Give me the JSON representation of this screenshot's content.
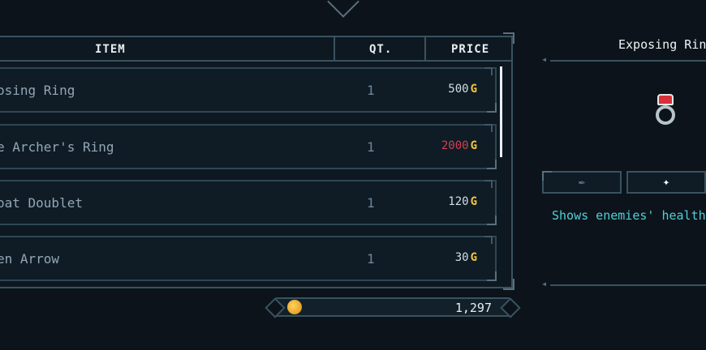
{
  "table": {
    "headers": {
      "item": "ITEM",
      "qty": "QT.",
      "price": "PRICE"
    },
    "rows": [
      {
        "name": "osing Ring",
        "qty": "1",
        "price": "500",
        "currency": "G",
        "affordable": true
      },
      {
        "name": "e Archer's Ring",
        "qty": "1",
        "price": "2000",
        "currency": "G",
        "affordable": false
      },
      {
        "name": "oat Doublet",
        "qty": "1",
        "price": "120",
        "currency": "G",
        "affordable": true
      },
      {
        "name": "en Arrow",
        "qty": "1",
        "price": "30",
        "currency": "G",
        "affordable": true
      }
    ]
  },
  "wallet": {
    "gold": "1,297",
    "icon": "coin-icon"
  },
  "detail": {
    "title": "Exposing Ring",
    "description": "Shows enemies' health.",
    "tabs": [
      {
        "icon": "feather-icon"
      },
      {
        "icon": "sparkle-icon"
      }
    ]
  },
  "colors": {
    "gold": "#f2c23a",
    "unaffordable": "#d04050",
    "description": "#4fd0d8"
  }
}
